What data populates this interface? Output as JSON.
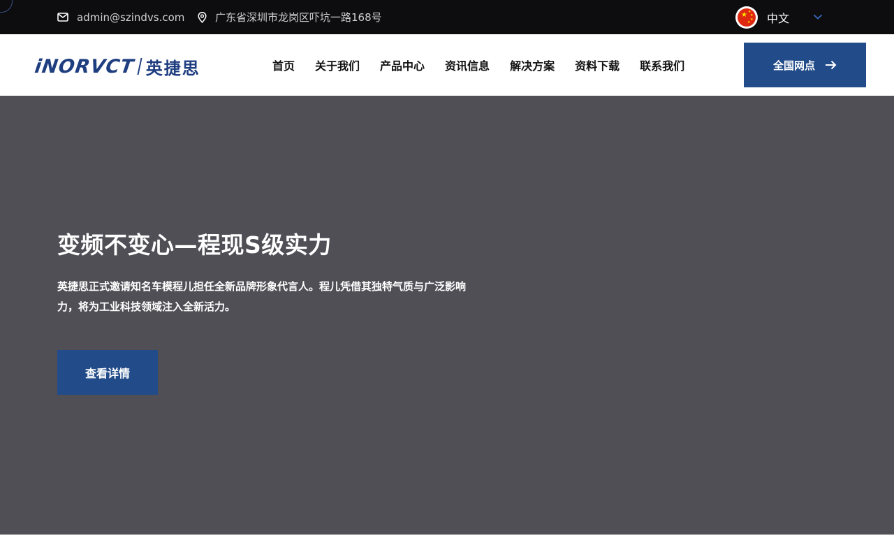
{
  "topbar": {
    "email": "admin@szindvs.com",
    "address": "广东省深圳市龙岗区吓坑一路168号",
    "language": "中文"
  },
  "header": {
    "logo_en": "iNORVCT",
    "logo_cn": "英捷思",
    "nav": [
      "首页",
      "关于我们",
      "产品中心",
      "资讯信息",
      "解决方案",
      "资料下载",
      "联系我们"
    ],
    "cta_label": "全国网点"
  },
  "hero": {
    "title": "变频不变心—程现S级实力",
    "description": "英捷思正式邀请知名车模程儿担任全新品牌形象代言人。程儿凭借其独特气质与广泛影响力，将为工业科技领域注入全新活力。",
    "button_label": "查看详情"
  },
  "colors": {
    "topbar_bg": "#0d0d0f",
    "brand_blue": "#224b89",
    "hero_bg": "#504f56",
    "logo_red": "#e3221b"
  },
  "icons": [
    "mail-icon",
    "location-pin-icon",
    "china-flag-icon",
    "chevron-down-icon",
    "arrow-right-icon"
  ]
}
